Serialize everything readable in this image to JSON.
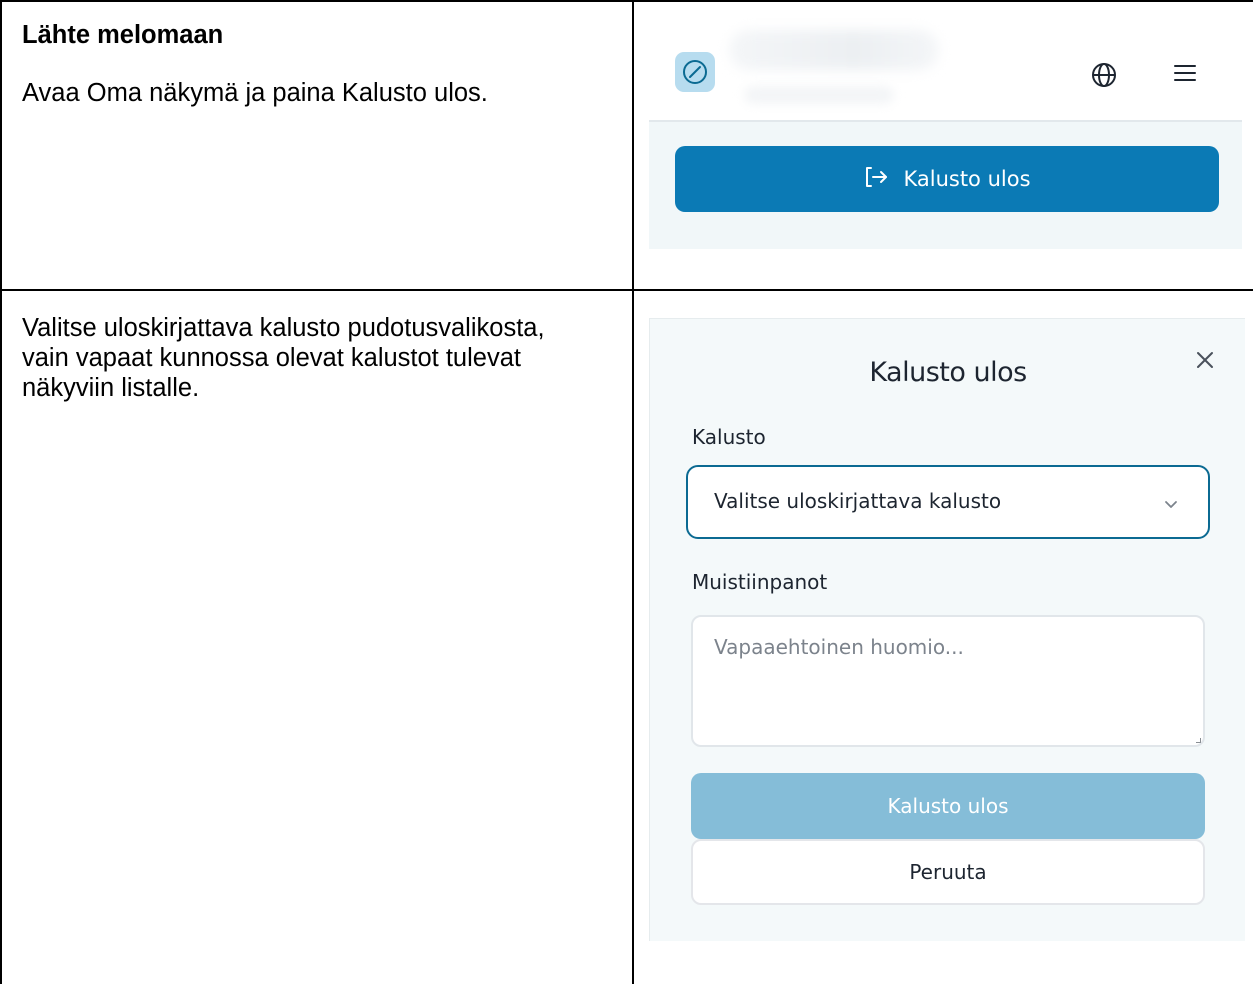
{
  "row1": {
    "heading": "Lähte melomaan",
    "instruction": "Avaa Oma näkymä ja paina Kalusto ulos.",
    "screenshot": {
      "button_label": "Kalusto ulos",
      "icons": [
        "compass-icon",
        "globe-icon",
        "menu-icon",
        "sign-out-icon"
      ]
    }
  },
  "row2": {
    "instruction": "Valitse uloskirjattava kalusto pudotusvalikosta, vain vapaat kunnossa olevat kalustot tulevat näkyviin listalle.",
    "screenshot": {
      "title": "Kalusto ulos",
      "equipment_label": "Kalusto",
      "equipment_selected": "Valitse uloskirjattava kalusto",
      "notes_label": "Muistiinpanot",
      "notes_placeholder": "Vapaaehtoinen huomio...",
      "submit_label": "Kalusto ulos",
      "cancel_label": "Peruuta",
      "icons": [
        "close-icon",
        "chevron-down-icon"
      ]
    }
  },
  "colors": {
    "primary": "#0b7ab5",
    "primary_disabled": "#85bdd8",
    "focus_border": "#0b6a92",
    "logo_bg": "#b7dcef"
  }
}
